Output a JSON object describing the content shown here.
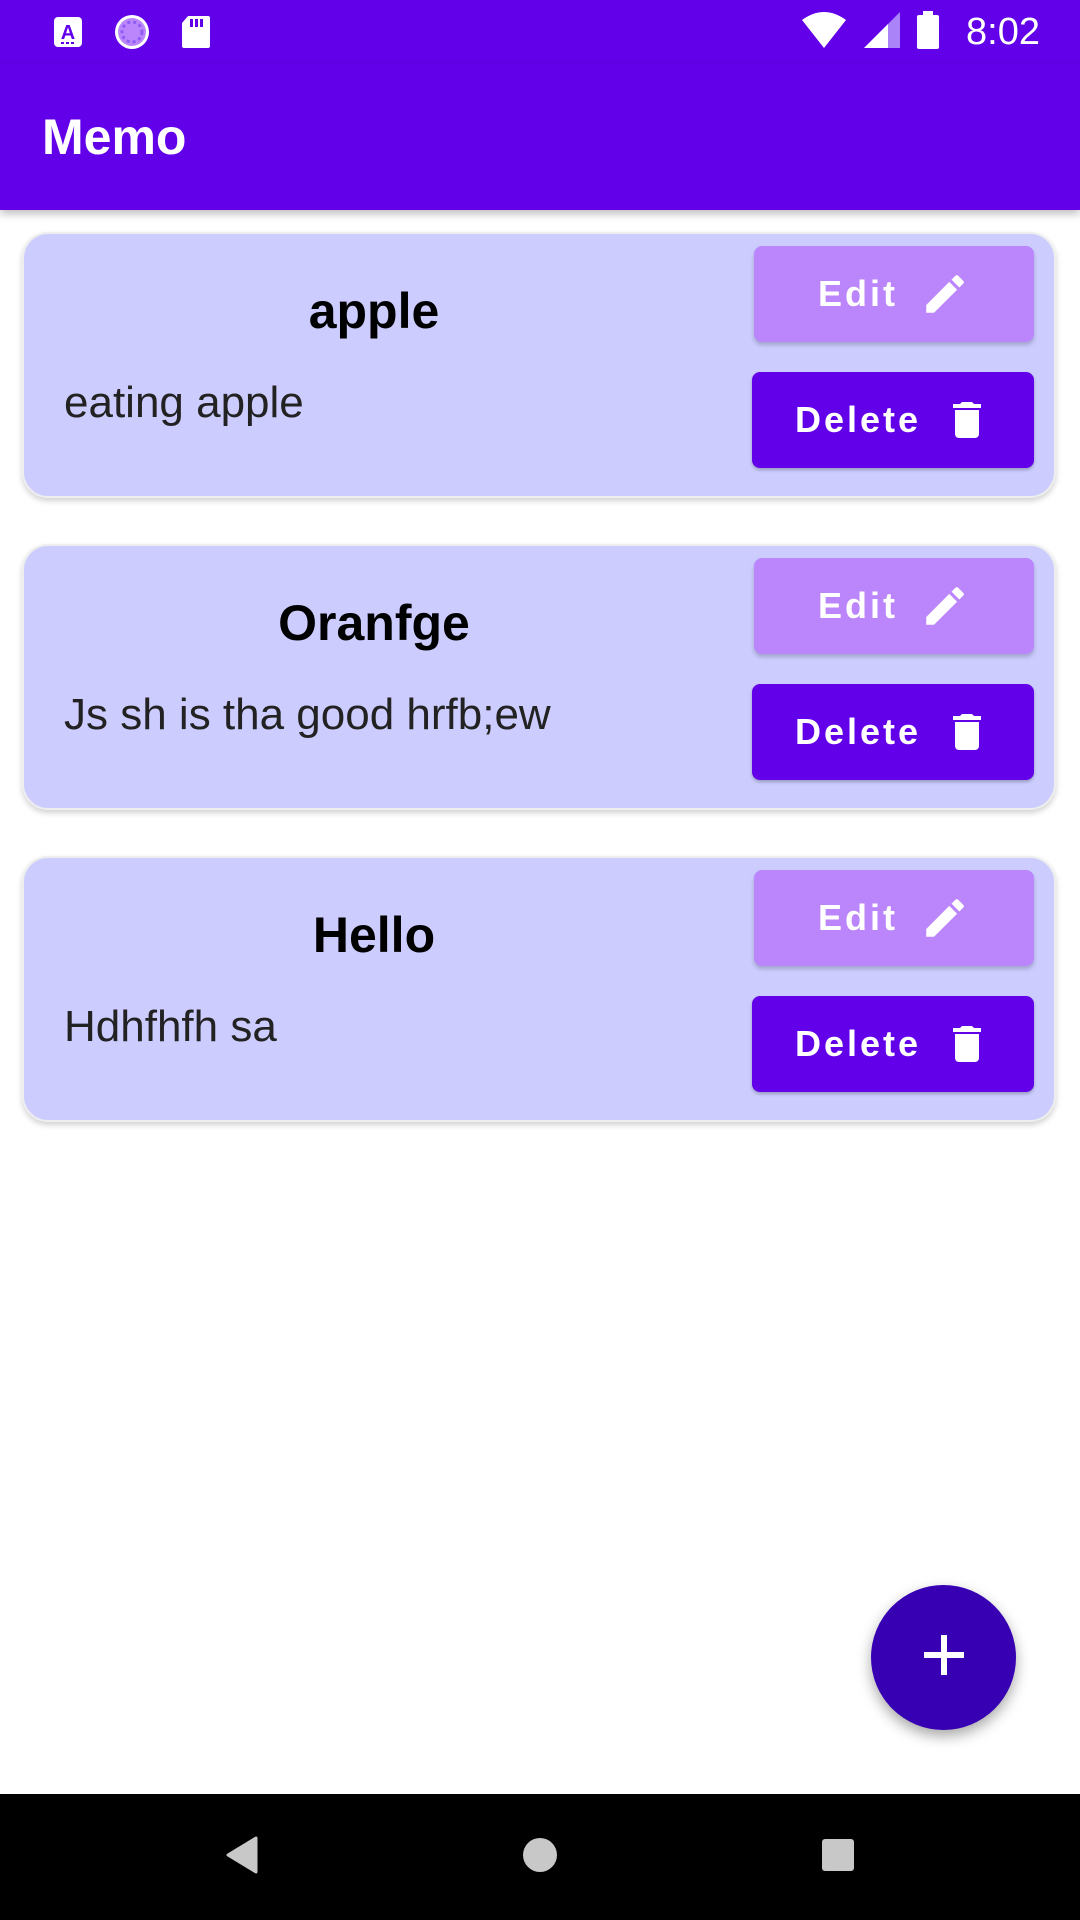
{
  "status_bar": {
    "time": "8:02",
    "icons": [
      "keyboard-a-icon",
      "loading-spinner-icon",
      "sd-card-icon",
      "wifi-icon",
      "signal-icon",
      "battery-icon"
    ]
  },
  "app_bar": {
    "title": "Memo"
  },
  "memos": [
    {
      "title": "apple",
      "content": "eating apple",
      "edit_label": "Edit",
      "delete_label": "Delete"
    },
    {
      "title": "Oranfge",
      "content": "Js sh is tha good hrfb;ew",
      "edit_label": "Edit",
      "delete_label": "Delete"
    },
    {
      "title": "Hello",
      "content": "Hdhfhfh sa",
      "edit_label": "Edit",
      "delete_label": "Delete"
    }
  ],
  "fab": {
    "icon": "plus-icon"
  },
  "navigation": {
    "buttons": [
      "back-icon",
      "home-icon",
      "recents-icon"
    ]
  },
  "colors": {
    "primary": "#6200EA",
    "primary_dark": "#3700B3",
    "accent": "#BB86FC",
    "card_background": "#CCCCFF"
  }
}
